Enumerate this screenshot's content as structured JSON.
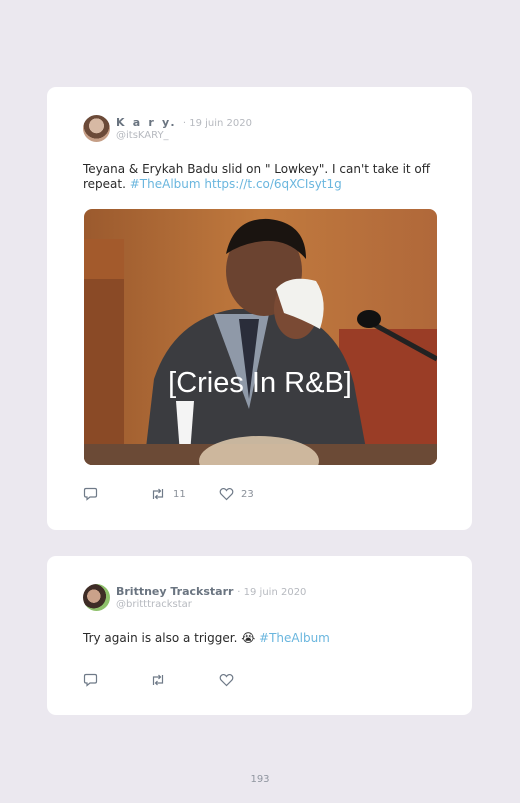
{
  "tweets": [
    {
      "name": "K a r y.",
      "date": "· 19 juin 2020",
      "handle": "@itsKARY_",
      "text": "Teyana & Erykah Badu slid on \" Lowkey\". I can't take it off repeat. ",
      "hashtag": "#TheAlbum",
      "link": "https://t.co/6qXCIsyt1g",
      "media_caption": "[Cries In R&B]",
      "retweets": "11",
      "likes": "23"
    },
    {
      "name": "Brittney Trackstarr",
      "date": "· 19 juin 2020",
      "handle": "@britttrackstar",
      "text": "Try again is also a trigger. 😭 ",
      "hashtag": "#TheAlbum"
    }
  ],
  "page_number": "193",
  "colors": {
    "background": "#ebe8ef",
    "card": "#ffffff",
    "link": "#6ab6de",
    "icon": "#6f7a88"
  },
  "icons": [
    "reply-icon",
    "retweet-icon",
    "like-icon"
  ]
}
